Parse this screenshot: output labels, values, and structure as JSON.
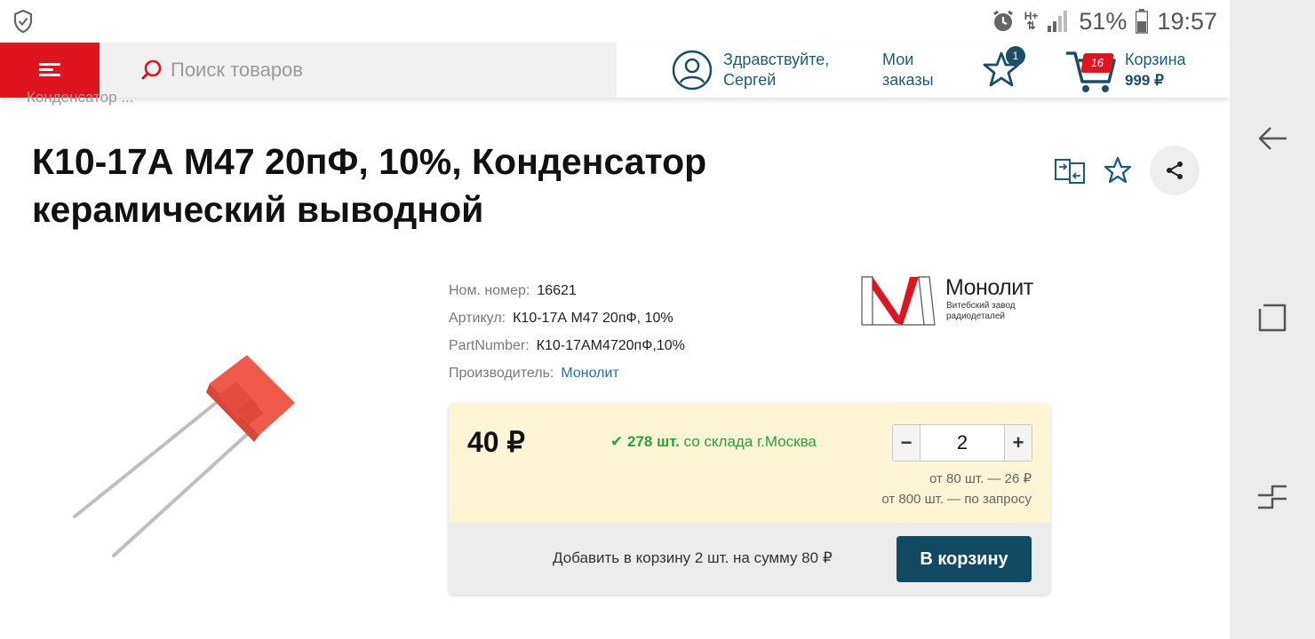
{
  "status_bar": {
    "battery": "51%",
    "time": "19:57",
    "network": "H+"
  },
  "header": {
    "search_placeholder": "Поиск товаров",
    "greeting_line1": "Здравствуйте,",
    "greeting_line2": "Сергей",
    "orders_line1": "Мои",
    "orders_line2": "заказы",
    "favorites_count": "1",
    "cart_count": "16",
    "cart_label": "Корзина",
    "cart_sum": "999 ₽"
  },
  "breadcrumb": "Конденсатор ...",
  "product": {
    "title_line1": "К10-17А М47 20пФ, 10%, Конденсатор",
    "title_line2": "керамический выводной",
    "specs": [
      {
        "label": "Ном. номер:",
        "value": "16621"
      },
      {
        "label": "Артикул:",
        "value": "К10-17А М47 20пФ, 10%"
      },
      {
        "label": "PartNumber:",
        "value": "К10-17АМ4720пФ,10%"
      },
      {
        "label": "Производитель:",
        "value": "Монолит"
      }
    ],
    "brand": {
      "name": "Монолит",
      "sub_line1": "Витебский завод",
      "sub_line2": "радиодеталей"
    }
  },
  "buybox": {
    "price": "40 ₽",
    "stock_count": "278 шт.",
    "stock_place": "со склада г.Москва",
    "quantity": "2",
    "minus": "−",
    "plus": "+",
    "tier1": "от 80 шт. — 26 ₽",
    "tier2": "от 800 шт. — по запросу",
    "add_summary": "Добавить в корзину 2 шт. на сумму 80 ₽",
    "cart_button": "В корзину"
  },
  "colors": {
    "brand_red": "#e0141f",
    "accent_dark": "#134a63",
    "link_blue": "#2a6fa0",
    "stock_green": "#2aa03a",
    "buybox_bg": "#fdf5d3"
  }
}
